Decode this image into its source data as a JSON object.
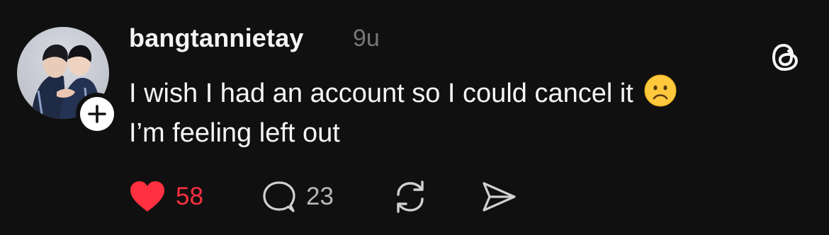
{
  "post": {
    "username": "bangtannietay",
    "time": "9u",
    "lines": [
      "I wish I had an account so I could cancel it",
      "I’m feeling left out"
    ],
    "emoji": "frowning-face",
    "likes": "58",
    "replies": "23"
  },
  "colors": {
    "background": "#101010",
    "text": "#f3f5f7",
    "muted": "#777777",
    "like_active": "#ff3040"
  },
  "icons": {
    "follow": "plus-icon",
    "app": "threads-logo",
    "like": "heart-icon",
    "reply": "speech-bubble-icon",
    "repost": "repost-icon",
    "share": "send-icon"
  }
}
